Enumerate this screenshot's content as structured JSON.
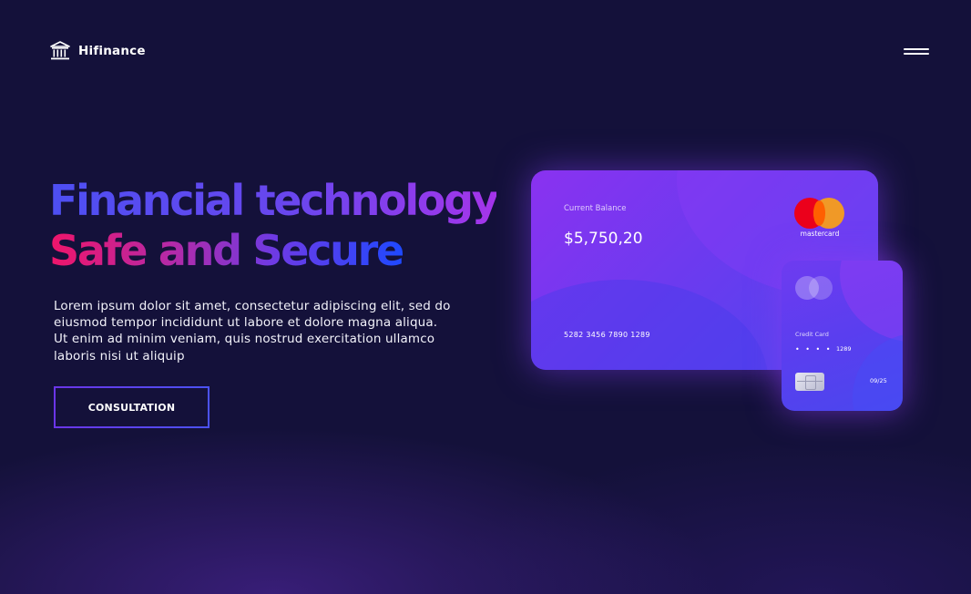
{
  "header": {
    "brand": "Hifinance",
    "logo_icon": "bank-icon",
    "menu_icon": "hamburger-menu-icon"
  },
  "hero": {
    "title_line1": "Financial technology",
    "title_line2": "Safe and Secure",
    "description": "Lorem ipsum dolor sit amet, consectetur adipiscing elit, sed do eiusmod tempor incididunt ut labore et dolore magna aliqua. Ut enim ad minim veniam, quis nostrud exercitation ullamco laboris nisi ut aliquip",
    "cta_label": "CONSULTATION"
  },
  "card_main": {
    "label": "Current Balance",
    "balance": "$5,750,20",
    "number": "5282 3456 7890 1289",
    "network": "mastercard"
  },
  "card_small": {
    "label": "Credit Card",
    "masked": "• • • •",
    "last_digits": "1289",
    "expiry": "09/25"
  },
  "colors": {
    "background": "#14113a",
    "accent_purple": "#8a32f0",
    "accent_blue": "#4a47ee",
    "accent_pink": "#f0156a"
  }
}
